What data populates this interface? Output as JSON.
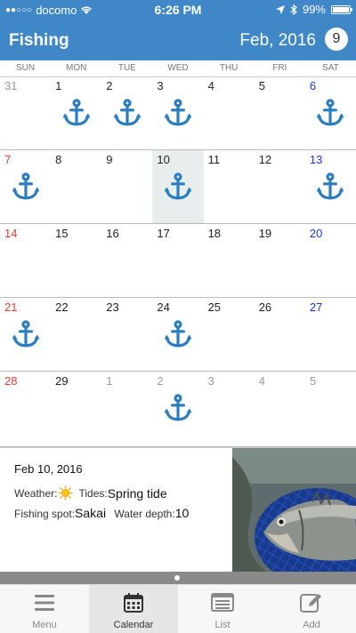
{
  "status": {
    "carrier": "docomo",
    "signal_dots": "●●○○○",
    "time": "6:26 PM",
    "battery": "99%",
    "battery_level": 0.99
  },
  "header": {
    "title": "Fishing",
    "month": "Feb, 2016",
    "today_day": "9"
  },
  "weekdays": [
    "SUN",
    "MON",
    "TUE",
    "WED",
    "THU",
    "FRI",
    "SAT"
  ],
  "calendar": {
    "weeks": [
      [
        {
          "d": "31",
          "t": "other"
        },
        {
          "d": "1",
          "i": true
        },
        {
          "d": "2",
          "i": true
        },
        {
          "d": "3",
          "i": true
        },
        {
          "d": "4"
        },
        {
          "d": "5"
        },
        {
          "d": "6",
          "t": "sat",
          "i": true
        }
      ],
      [
        {
          "d": "7",
          "t": "sun",
          "i": true
        },
        {
          "d": "8"
        },
        {
          "d": "9"
        },
        {
          "d": "10",
          "i": true,
          "sel": true
        },
        {
          "d": "11"
        },
        {
          "d": "12"
        },
        {
          "d": "13",
          "t": "sat",
          "i": true
        }
      ],
      [
        {
          "d": "14",
          "t": "sun"
        },
        {
          "d": "15"
        },
        {
          "d": "16"
        },
        {
          "d": "17"
        },
        {
          "d": "18"
        },
        {
          "d": "19"
        },
        {
          "d": "20",
          "t": "sat"
        }
      ],
      [
        {
          "d": "21",
          "t": "sun",
          "i": true
        },
        {
          "d": "22"
        },
        {
          "d": "23"
        },
        {
          "d": "24",
          "i": true
        },
        {
          "d": "25"
        },
        {
          "d": "26"
        },
        {
          "d": "27",
          "t": "sat"
        }
      ],
      [
        {
          "d": "28",
          "t": "sun"
        },
        {
          "d": "29"
        },
        {
          "d": "1",
          "t": "other"
        },
        {
          "d": "2",
          "t": "other",
          "i": true
        },
        {
          "d": "3",
          "t": "other"
        },
        {
          "d": "4",
          "t": "other"
        },
        {
          "d": "5",
          "t": "other"
        }
      ]
    ]
  },
  "detail": {
    "date": "Feb 10, 2016",
    "weather_label": "Weather:",
    "weather_icon": "sun-icon",
    "tides_label": "Tides:",
    "tides_value": "Spring tide",
    "spot_label": "Fishing spot:",
    "spot_value": "Sakai",
    "depth_label": "Water depth:",
    "depth_value": "10"
  },
  "tabs": [
    {
      "label": "Menu",
      "icon": "menu-icon",
      "active": false
    },
    {
      "label": "Calendar",
      "icon": "calendar-icon",
      "active": true
    },
    {
      "label": "List",
      "icon": "list-icon",
      "active": false
    },
    {
      "label": "Add",
      "icon": "edit-icon",
      "active": false
    }
  ],
  "colors": {
    "header": "#3f87c6",
    "anchor": "#2a7dc0",
    "sunday": "#e53935",
    "saturday": "#2335d6"
  }
}
